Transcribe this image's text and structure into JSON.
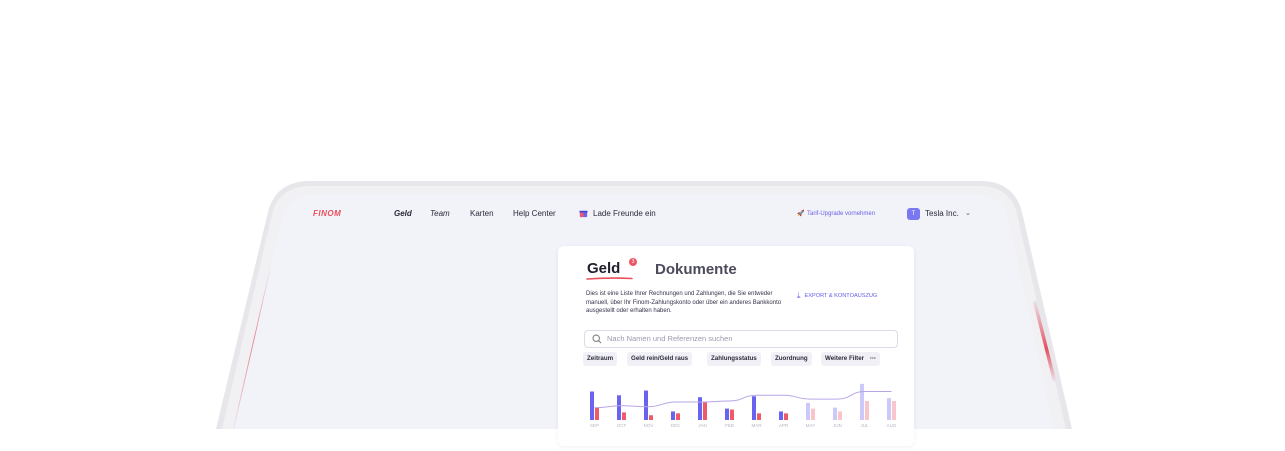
{
  "nav": {
    "logo": "FINOM",
    "items": [
      "Geld",
      "Team",
      "Karten",
      "Help Center"
    ],
    "invite": "Lade Freunde ein",
    "upgrade": "Tarif-Upgrade vornehmen",
    "org_initial": "T",
    "org_name": "Tesla Inc."
  },
  "tabs": {
    "active": "Geld",
    "badge": "3",
    "other": "Dokumente"
  },
  "description": "Dies ist eine Liste Ihrer Rechnungen und Zahlungen, die Sie entweder manuell, über Ihr Finom-Zahlungskonto oder über ein anderes Bankkonto ausgestellt oder erhalten haben.",
  "export_label": "EXPORT & KONTOAUSZUG",
  "search": {
    "placeholder": "Nach Namen und Referenzen suchen"
  },
  "filters": [
    "Zeitraum",
    "Geld rein/Geld raus",
    "Zahlungsstatus",
    "Zuordnung",
    "Weitere Filter"
  ],
  "colors": {
    "accent": "#5e5ee8",
    "bar_in": "#6a63ef",
    "bar_out": "#ef5a6a",
    "line": "#b8a6e6",
    "logo": "#e8505b"
  },
  "chart_data": {
    "type": "bar",
    "categories": [
      "SEP",
      "OCT",
      "NOV",
      "DEC",
      "JAN",
      "FEB",
      "MAR",
      "APR",
      "MAY",
      "JUN",
      "JUL",
      "AUG"
    ],
    "series": [
      {
        "values": [
          30,
          26,
          31,
          9,
          24,
          12,
          25,
          9,
          18,
          13,
          38,
          23
        ]
      },
      {
        "values": [
          13,
          8,
          5,
          7,
          19,
          11,
          7,
          7,
          12,
          9,
          20,
          20
        ]
      },
      {
        "values": [
          13,
          15,
          14,
          19,
          19,
          20,
          26,
          26,
          22,
          22,
          30,
          30
        ]
      }
    ],
    "future_months": [
      "MAY",
      "JUN",
      "JUL",
      "AUG"
    ],
    "ylim": [
      0,
      40
    ]
  }
}
